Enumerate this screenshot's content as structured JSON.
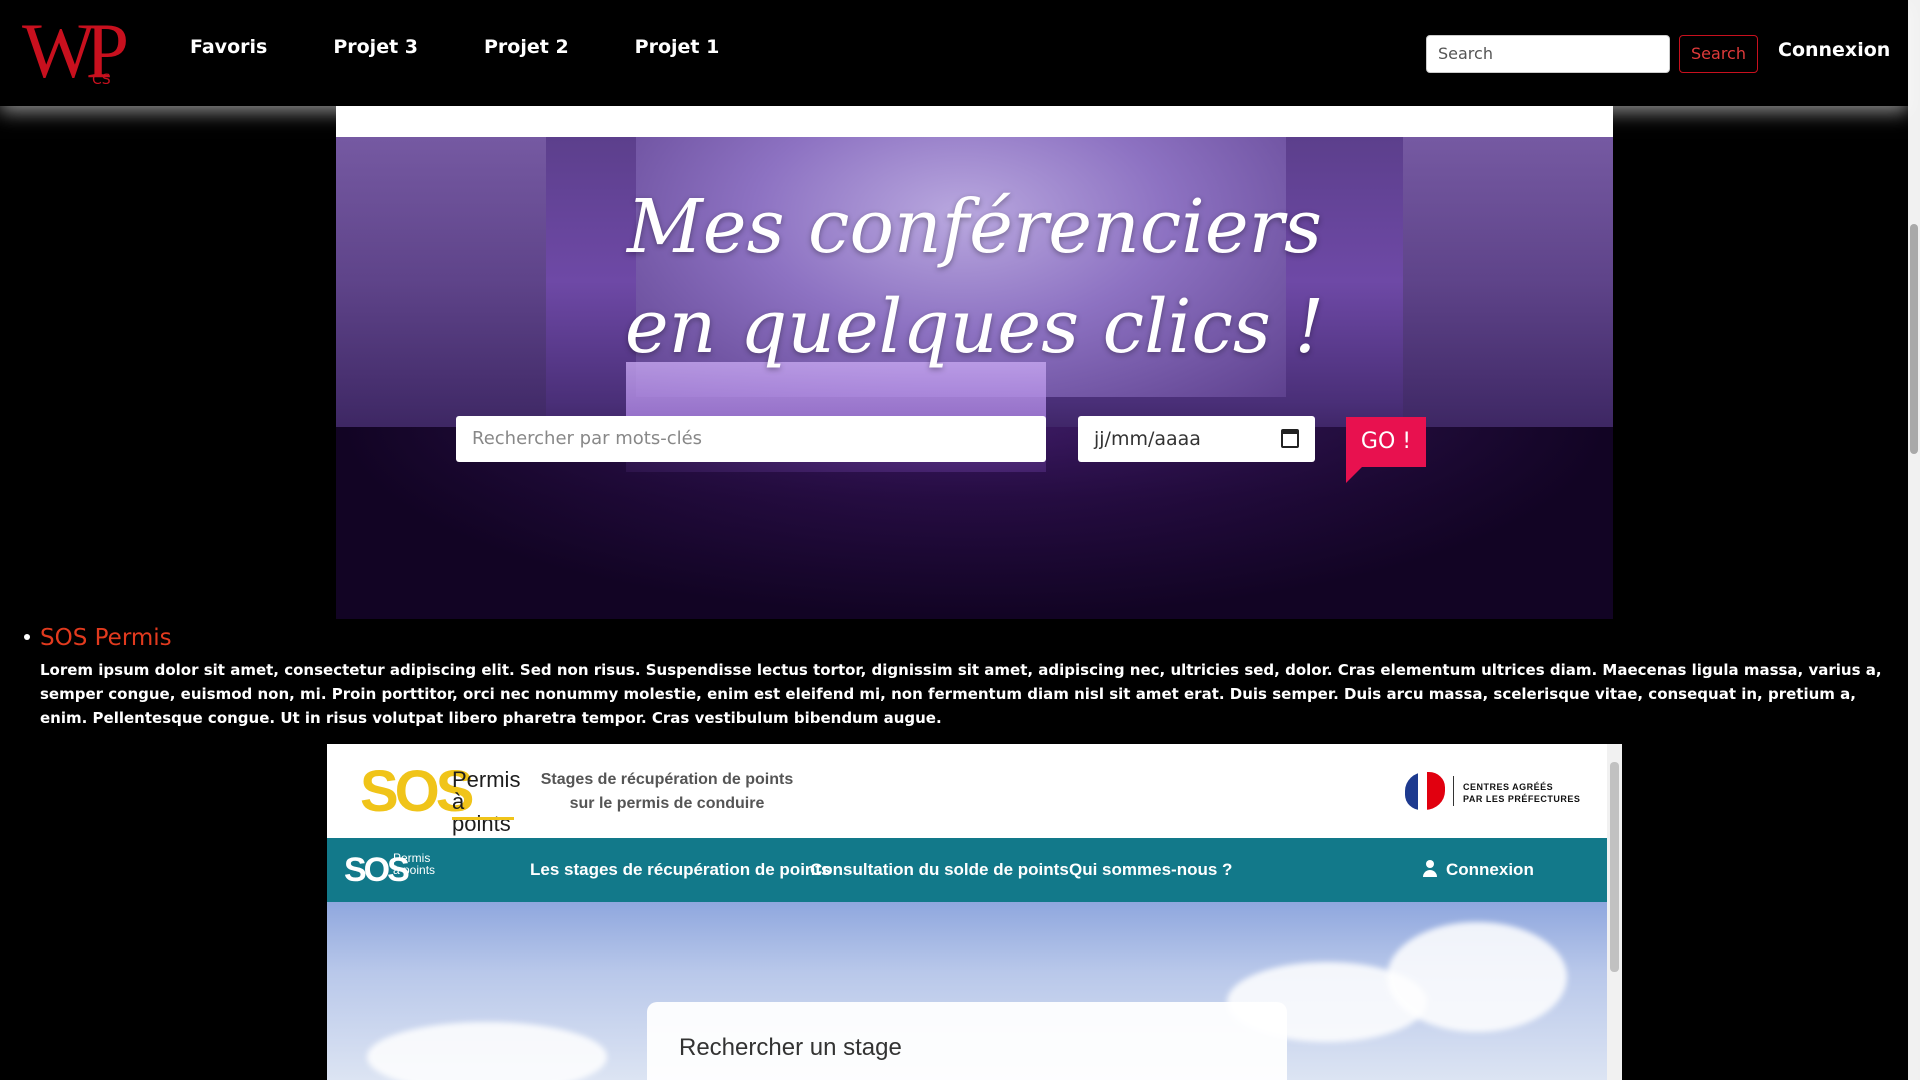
{
  "nav": {
    "logo_main": "WP",
    "logo_sub": "CS",
    "links": [
      "Favoris",
      "Projet 3",
      "Projet 2",
      "Projet 1"
    ],
    "search_placeholder": "Search",
    "search_button": "Search",
    "login": "Connexion"
  },
  "hero": {
    "title_line1": "Mes conférenciers",
    "title_line2": "en quelques clics !",
    "keyword_placeholder": "Rechercher par mots-clés",
    "date_placeholder": "jj/mm/aaaa",
    "go_button": "GO !"
  },
  "item": {
    "title": "SOS Permis",
    "description": "Lorem ipsum dolor sit amet, consectetur adipiscing elit. Sed non risus. Suspendisse lectus tortor, dignissim sit amet, adipiscing nec, ultricies sed, dolor. Cras elementum ultrices diam. Maecenas ligula massa, varius a, semper congue, euismod non, mi. Proin porttitor, orci nec nonummy molestie, enim est eleifend mi, non fermentum diam nisl sit amet erat. Duis semper. Duis arcu massa, scelerisque vitae, consequat in, pretium a, enim. Pellentesque congue. Ut in risus volutpat libero pharetra tempor. Cras vestibulum bibendum augue."
  },
  "embed": {
    "logo_letters": "SOS",
    "logo_sub1": "Permis",
    "logo_sub2": "à points",
    "tagline1": "Stages de récupération de points",
    "tagline2": "sur le permis de conduire",
    "prefecture1": "CENTRES AGRÉÉS",
    "prefecture2": "PAR LES PRÉFECTURES",
    "nav_links": [
      "Les stages de récupération de points",
      "Consultation du solde de points",
      "Qui sommes-nous ?",
      "Connexion"
    ],
    "search_title": "Rechercher un stage"
  },
  "colors": {
    "brand_red": "#c8101e",
    "go_pink": "#e8114f",
    "teal_nav": "#12798a",
    "sos_yellow": "#f0c419"
  }
}
